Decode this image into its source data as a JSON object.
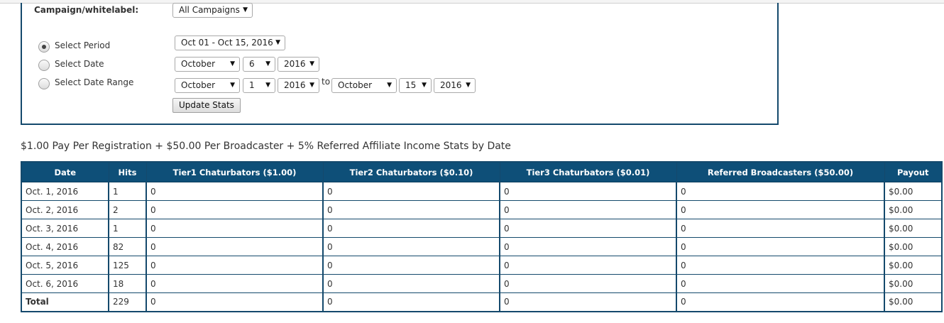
{
  "filters": {
    "campaign_label": "Campaign/whitelabel:",
    "campaign_value": "All Campaigns",
    "period_label": "Select Period",
    "period_value": "Oct 01 - Oct 15, 2016",
    "date_label": "Select Date",
    "date_month": "October",
    "date_day": "6",
    "date_year": "2016",
    "range_label": "Select Date Range",
    "range_from_month": "October",
    "range_from_day": "1",
    "range_from_year": "2016",
    "range_to_text": "to",
    "range_to_month": "October",
    "range_to_day": "15",
    "range_to_year": "2016",
    "update_button": "Update Stats",
    "selected_option": "Select Period"
  },
  "stats": {
    "heading": "$1.00 Pay Per Registration + $50.00 Per Broadcaster + 5% Referred Affiliate Income Stats by Date",
    "columns": [
      "Date",
      "Hits",
      "Tier1 Chaturbators ($1.00)",
      "Tier2 Chaturbators ($0.10)",
      "Tier3 Chaturbators ($0.01)",
      "Referred Broadcasters ($50.00)",
      "Payout"
    ],
    "rows": [
      [
        "Oct. 1, 2016",
        "1",
        "0",
        "0",
        "0",
        "0",
        "$0.00"
      ],
      [
        "Oct. 2, 2016",
        "2",
        "0",
        "0",
        "0",
        "0",
        "$0.00"
      ],
      [
        "Oct. 3, 2016",
        "1",
        "0",
        "0",
        "0",
        "0",
        "$0.00"
      ],
      [
        "Oct. 4, 2016",
        "82",
        "0",
        "0",
        "0",
        "0",
        "$0.00"
      ],
      [
        "Oct. 5, 2016",
        "125",
        "0",
        "0",
        "0",
        "0",
        "$0.00"
      ],
      [
        "Oct. 6, 2016",
        "18",
        "0",
        "0",
        "0",
        "0",
        "$0.00"
      ],
      [
        "Total",
        "229",
        "0",
        "0",
        "0",
        "0",
        "$0.00"
      ]
    ]
  },
  "colors": {
    "header_bg": "#0e4f78",
    "border": "#14496c"
  }
}
